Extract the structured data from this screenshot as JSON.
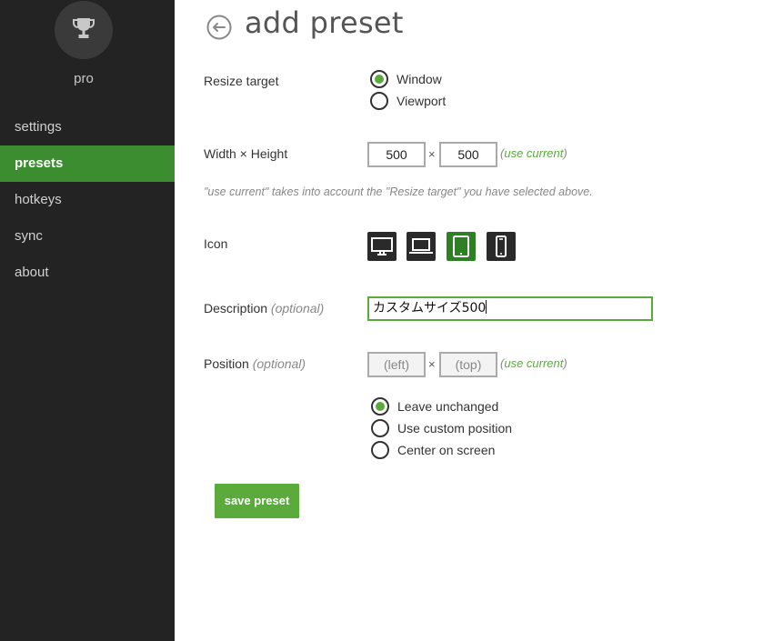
{
  "sidebar": {
    "account_label": "pro",
    "items": [
      {
        "label": "settings",
        "active": false
      },
      {
        "label": "presets",
        "active": true
      },
      {
        "label": "hotkeys",
        "active": false
      },
      {
        "label": "sync",
        "active": false
      },
      {
        "label": "about",
        "active": false
      }
    ]
  },
  "header": {
    "title": "add preset"
  },
  "resize_target": {
    "label": "Resize target",
    "options": [
      {
        "label": "Window",
        "checked": true
      },
      {
        "label": "Viewport",
        "checked": false
      }
    ]
  },
  "dimensions": {
    "label": "Width × Height",
    "width": "500",
    "height": "500",
    "separator": "×",
    "use_current": "use current",
    "hint": "\"use current\" takes into account the \"Resize target\" you have selected above."
  },
  "icon": {
    "label": "Icon",
    "options": [
      "desktop-icon",
      "laptop-icon",
      "tablet-icon",
      "phone-icon"
    ],
    "selected": "tablet-icon"
  },
  "description": {
    "label": "Description",
    "optional": "(optional)",
    "value": "カスタムサイズ500"
  },
  "position": {
    "label": "Position",
    "optional": "(optional)",
    "left_placeholder": "(left)",
    "top_placeholder": "(top)",
    "separator": "×",
    "use_current": "use current",
    "options": [
      {
        "label": "Leave unchanged",
        "checked": true
      },
      {
        "label": "Use custom position",
        "checked": false
      },
      {
        "label": "Center on screen",
        "checked": false
      }
    ]
  },
  "actions": {
    "save_label": "save preset"
  },
  "colors": {
    "accent": "#5aaa3c",
    "active_nav": "#3c8d2f",
    "sidebar_bg": "#232323"
  }
}
